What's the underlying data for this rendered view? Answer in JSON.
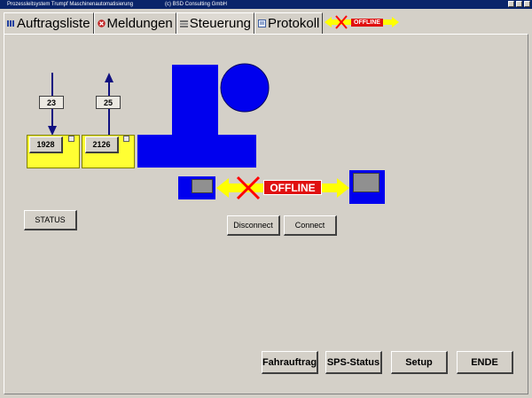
{
  "window": {
    "title": "Prozessleitsystem Trumpf Maschinenautomatisierung",
    "copyright": "(c) BSD Consulting GmbH"
  },
  "tabs": [
    {
      "label": "Auftragsliste",
      "icon": "list-icon"
    },
    {
      "label": "Meldungen",
      "icon": "error-icon"
    },
    {
      "label": "Steuerung",
      "icon": "control-icon"
    },
    {
      "label": "Protokoll",
      "icon": "log-icon"
    }
  ],
  "header_status": {
    "label": "OFFLINE"
  },
  "stations": {
    "left": {
      "counter": "23",
      "value": "1928",
      "arrow": "down"
    },
    "right": {
      "counter": "25",
      "value": "2126",
      "arrow": "up"
    }
  },
  "connection": {
    "status": "OFFLINE"
  },
  "buttons": {
    "status": "STATUS",
    "disconnect": "Disconnect",
    "connect": "Connect",
    "fahrauftrag": "Fahrauftrag",
    "sps_status": "SPS-Status",
    "setup": "Setup",
    "ende": "ENDE"
  },
  "colors": {
    "machine_blue": "#0000ee",
    "station_yellow": "#ffff33",
    "offline_red": "#e01010",
    "arrow_yellow": "#ffff00",
    "cross_red": "#ff0000"
  }
}
